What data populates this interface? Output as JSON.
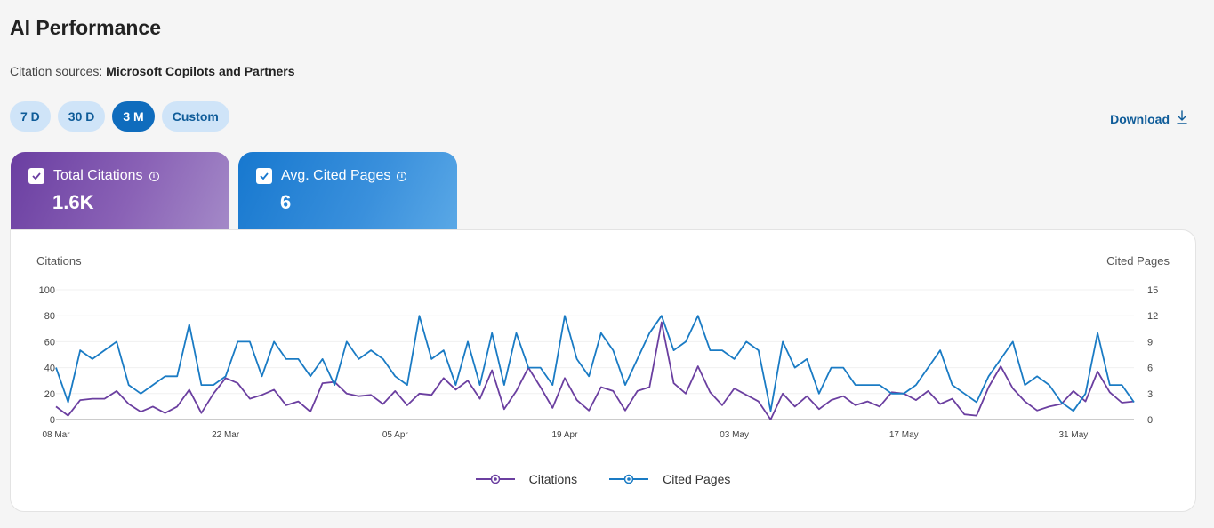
{
  "page": {
    "title": "AI Performance"
  },
  "sources": {
    "label": "Citation sources:",
    "value": "Microsoft Copilots and Partners"
  },
  "ranges": [
    {
      "label": "7 D",
      "active": false
    },
    {
      "label": "30 D",
      "active": false
    },
    {
      "label": "3 M",
      "active": true
    },
    {
      "label": "Custom",
      "active": false
    }
  ],
  "download": {
    "label": "Download"
  },
  "cards": [
    {
      "label": "Total Citations",
      "value": "1.6K"
    },
    {
      "label": "Avg. Cited Pages",
      "value": "6"
    }
  ],
  "colors": {
    "citations": "#6b3fa0",
    "cited_pages": "#1a7bc4"
  },
  "chart_data": {
    "type": "line",
    "ylabel_left": "Citations",
    "ylabel_right": "Cited Pages",
    "ylim_left": [
      0,
      100
    ],
    "ylim_right": [
      0,
      15
    ],
    "yticks_left": [
      "0",
      "20",
      "40",
      "60",
      "80",
      "100"
    ],
    "yticks_right": [
      "0",
      "3",
      "6",
      "9",
      "12",
      "15"
    ],
    "x_ticks": [
      {
        "index": 0,
        "label": "08 Mar"
      },
      {
        "index": 14,
        "label": "22 Mar"
      },
      {
        "index": 28,
        "label": "05 Apr"
      },
      {
        "index": 42,
        "label": "19 Apr"
      },
      {
        "index": 56,
        "label": "03 May"
      },
      {
        "index": 70,
        "label": "17 May"
      },
      {
        "index": 84,
        "label": "31 May"
      }
    ],
    "grid": true,
    "legend_position": "bottom",
    "series": [
      {
        "name": "Citations",
        "axis": "left",
        "values": [
          10,
          3,
          15,
          16,
          16,
          22,
          12,
          6,
          10,
          5,
          10,
          23,
          5,
          20,
          32,
          28,
          16,
          19,
          23,
          11,
          14,
          6,
          28,
          29,
          20,
          18,
          19,
          12,
          22,
          11,
          20,
          19,
          32,
          23,
          30,
          16,
          38,
          8,
          22,
          40,
          25,
          9,
          32,
          15,
          7,
          25,
          22,
          7,
          22,
          25,
          75,
          28,
          20,
          41,
          21,
          11,
          24,
          19,
          14,
          0,
          20,
          10,
          18,
          8,
          15,
          18,
          11,
          14,
          10,
          21,
          20,
          15,
          22,
          12,
          16,
          4,
          3,
          25,
          41,
          24,
          14,
          7,
          10,
          12,
          22,
          14,
          37,
          21,
          13,
          14
        ]
      },
      {
        "name": "Cited Pages",
        "axis": "right",
        "values": [
          6,
          2,
          8,
          7,
          8,
          9,
          4,
          3,
          4,
          5,
          5,
          11,
          4,
          4,
          5,
          9,
          9,
          5,
          9,
          7,
          7,
          5,
          7,
          4,
          9,
          7,
          8,
          7,
          5,
          4,
          12,
          7,
          8,
          4,
          9,
          4,
          10,
          4,
          10,
          6,
          6,
          4,
          12,
          7,
          5,
          10,
          8,
          4,
          7,
          10,
          12,
          8,
          9,
          12,
          8,
          8,
          7,
          9,
          8,
          1,
          9,
          6,
          7,
          3,
          6,
          6,
          4,
          4,
          4,
          3,
          3,
          4,
          6,
          8,
          4,
          3,
          2,
          5,
          7,
          9,
          4,
          5,
          4,
          2,
          1,
          3,
          10,
          4,
          4,
          2
        ]
      }
    ]
  }
}
